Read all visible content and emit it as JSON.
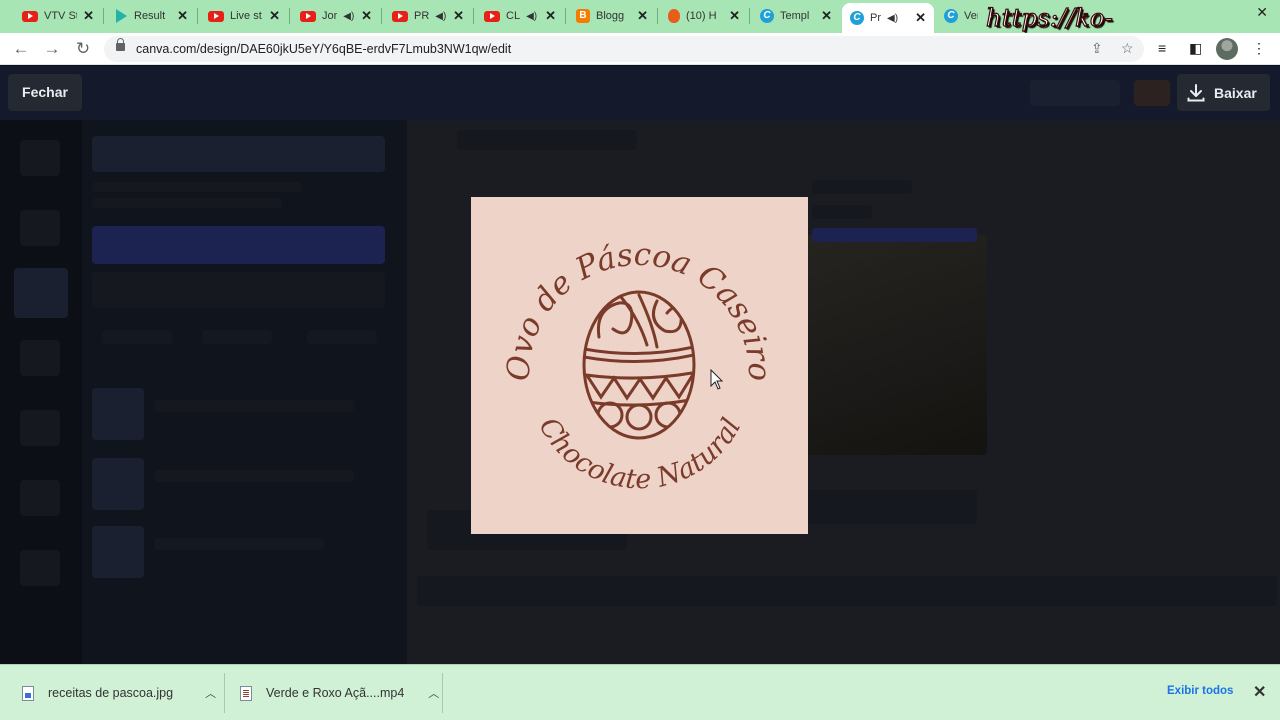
{
  "browser": {
    "tabs": [
      {
        "title": "VTV St",
        "favicon": "youtube-icon",
        "audio": false
      },
      {
        "title": "Result",
        "favicon": "play-icon",
        "audio": false
      },
      {
        "title": "Live st",
        "favicon": "youtube-icon",
        "audio": false
      },
      {
        "title": "Jor",
        "favicon": "youtube-icon",
        "audio": true
      },
      {
        "title": "PR",
        "favicon": "youtube-icon",
        "audio": true
      },
      {
        "title": "CL",
        "favicon": "youtube-icon",
        "audio": true
      },
      {
        "title": "Blogg",
        "favicon": "blogger-icon",
        "audio": false
      },
      {
        "title": "(10) H",
        "favicon": "fire-icon",
        "audio": false
      },
      {
        "title": "Templ",
        "favicon": "canva-icon",
        "audio": false
      },
      {
        "title": "Pr",
        "favicon": "canva-icon",
        "audio": true,
        "active": true
      },
      {
        "title": "Verd",
        "favicon": "canva-icon",
        "audio": false
      }
    ],
    "url": "canva.com/design/DAE60jkU5eY/Y6qBE-erdvF7Lmub3NW1qw/edit",
    "watermark": "https://ko-fi.com/gokagen"
  },
  "overlay": {
    "close_label": "Fechar",
    "download_label": "Baixar"
  },
  "preview": {
    "top_arc_text": "Ovo de Páscoa Caseiro",
    "bottom_arc_text": "Chocolate Natural",
    "background_color": "#eed3c8",
    "ink_color": "#7a3b2a"
  },
  "downloads": {
    "items": [
      {
        "name": "receitas de pascoa.jpg",
        "type": "image"
      },
      {
        "name": "Verde e Roxo Açã....mp4",
        "type": "video"
      }
    ],
    "show_all_label": "Exibir todos"
  }
}
